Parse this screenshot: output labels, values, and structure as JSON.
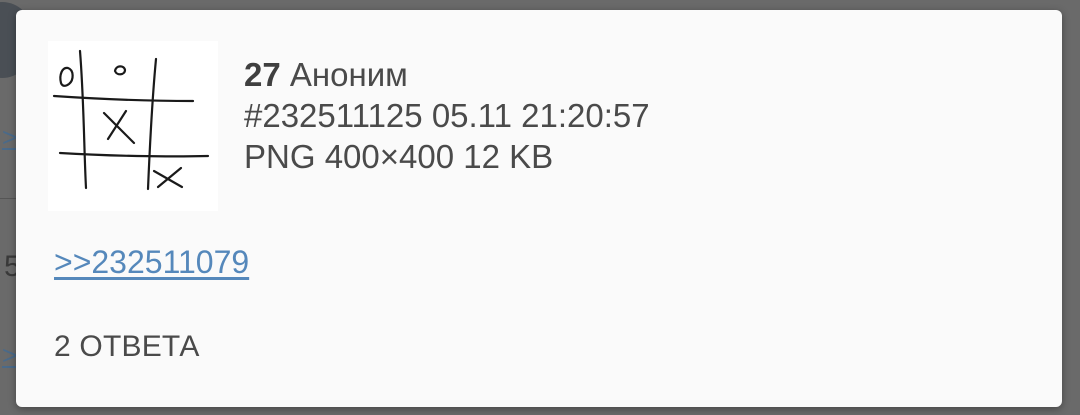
{
  "background": {
    "link_1": ">",
    "digit": "5",
    "link_2": ">"
  },
  "post": {
    "number": "27",
    "author": "Аноним",
    "id": "#232511125",
    "date": "05.11",
    "time": "21:20:57",
    "file_type": "PNG",
    "file_dims": "400×400",
    "file_size": "12 KB",
    "thumbnail_marks": {
      "o_top_left": "o",
      "o_top_mid": "o",
      "x_center": "X",
      "x_bottom_right": "X"
    },
    "reply_link": ">>232511079",
    "answers_label": "2 ОТВЕТА"
  },
  "colors": {
    "link": "#5588bb",
    "text": "#4a4a4a",
    "card": "#fafafa",
    "overlay": "#6a6a6a"
  }
}
